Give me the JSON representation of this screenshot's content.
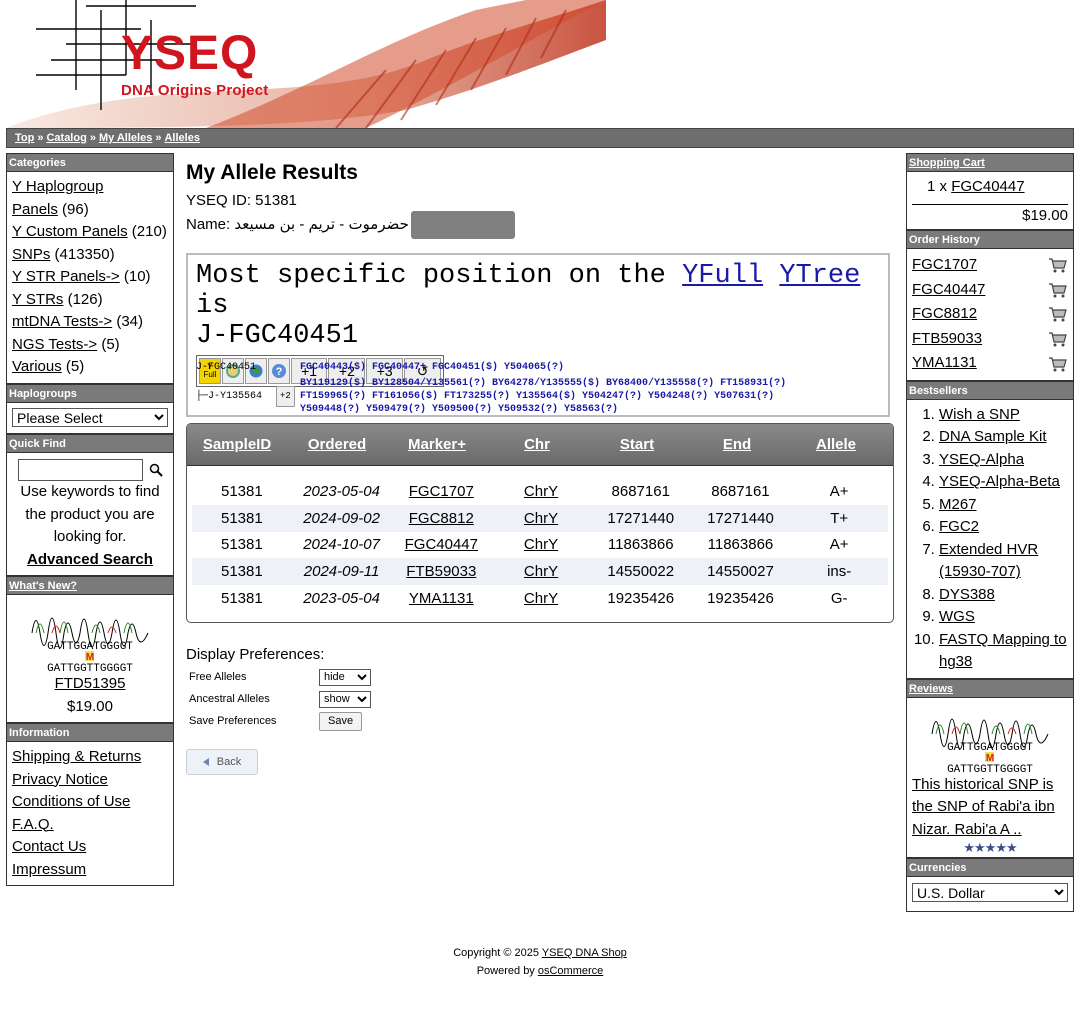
{
  "header": {
    "logo_title": "YSEQ",
    "logo_subtitle": "DNA Origins Project"
  },
  "breadcrumb": [
    "Top",
    "Catalog",
    "My Alleles",
    "Alleles"
  ],
  "categories": {
    "title": "Categories",
    "items": [
      {
        "label": "Y Haplogroup",
        "count": ""
      },
      {
        "label": "Panels",
        "count": "(96)"
      },
      {
        "label": "Y Custom Panels",
        "count": "(210)"
      },
      {
        "label": "SNPs",
        "count": "(413350)"
      },
      {
        "label": "Y STR Panels->",
        "count": "(10)"
      },
      {
        "label": "Y STRs",
        "count": "(126)"
      },
      {
        "label": "mtDNA Tests->",
        "count": "(34)"
      },
      {
        "label": "NGS Tests->",
        "count": "(5)"
      },
      {
        "label": "Various",
        "count": "(5)"
      }
    ]
  },
  "haplogroups": {
    "title": "Haplogroups",
    "selected": "Please Select"
  },
  "quick_find": {
    "title": "Quick Find",
    "help": "Use keywords to find the product you are looking for.",
    "advanced": "Advanced Search"
  },
  "whats_new": {
    "title": "What's New?",
    "product": "FTD51395",
    "price": "$19.00"
  },
  "information": {
    "title": "Information",
    "items": [
      "Shipping & Returns",
      "Privacy Notice",
      "Conditions of Use",
      "F.A.Q.",
      "Contact Us",
      "Impressum"
    ]
  },
  "main": {
    "title": "My Allele Results",
    "yseq_id_label": "YSEQ ID: 51381",
    "name_label": "Name:",
    "name_value": "حضرموت - تريم - بن مسيعد",
    "yfull": {
      "prefix": "Most specific position on the",
      "link1": "YFull",
      "link2": "YTree",
      "suffix": "is",
      "haplogroup": "J-FGC40451",
      "buttons": [
        "Y Full",
        "",
        "",
        "?",
        "+1",
        "+2",
        "+3",
        "↺"
      ]
    },
    "snp_rows": {
      "node1": "J-FGC40451",
      "node1_snps": "FGC40443($)  FGC40447+  FGC40451($)  Y504065(?)",
      "node2": "├─J-Y135564",
      "node2_button": "+2",
      "node2_line1": "BY119129($)  BY128504/Y135561(?)  BY64278/Y135555($)  BY68400/Y135558(?)  FT158931(?)",
      "node2_line2": "FT159965(?)  FT161056($)  FT173255(?)  Y135564($)  Y504247(?)  Y504248(?)  Y507631(?)",
      "node2_line3": "Y509448(?)  Y509479(?)  Y509500(?)  Y509532(?)  Y58563(?)"
    },
    "table": {
      "headers": [
        "SampleID",
        "Ordered",
        "Marker+",
        "Chr",
        "Start",
        "End",
        "Allele"
      ],
      "rows": [
        [
          "51381",
          "2023-05-04",
          "FGC1707",
          "ChrY",
          "8687161",
          "8687161",
          "A+"
        ],
        [
          "51381",
          "2024-09-02",
          "FGC8812",
          "ChrY",
          "17271440",
          "17271440",
          "T+"
        ],
        [
          "51381",
          "2024-10-07",
          "FGC40447",
          "ChrY",
          "11863866",
          "11863866",
          "A+"
        ],
        [
          "51381",
          "2024-09-11",
          "FTB59033",
          "ChrY",
          "14550022",
          "14550027",
          "ins-"
        ],
        [
          "51381",
          "2023-05-04",
          "YMA1131",
          "ChrY",
          "19235426",
          "19235426",
          "G-"
        ]
      ]
    },
    "prefs": {
      "title": "Display Preferences:",
      "free_label": "Free Alleles",
      "free_value": "hide",
      "anc_label": "Ancestral Alleles",
      "anc_value": "show",
      "save_label": "Save Preferences",
      "save_button": "Save"
    },
    "back": "Back"
  },
  "cart": {
    "title": "Shopping Cart",
    "qty": "1 x",
    "item": "FGC40447",
    "total": "$19.00"
  },
  "order_history": {
    "title": "Order History",
    "items": [
      "FGC1707",
      "FGC40447",
      "FGC8812",
      "FTB59033",
      "YMA1131"
    ]
  },
  "bestsellers": {
    "title": "Bestsellers",
    "items": [
      "Wish a SNP",
      "DNA Sample Kit",
      "YSEQ-Alpha",
      "YSEQ-Alpha-Beta",
      "M267",
      "FGC2",
      "Extended HVR (15930-707)",
      "DYS388",
      "WGS",
      "FASTQ Mapping to hg38"
    ]
  },
  "reviews": {
    "title": "Reviews",
    "text": "This historical SNP is the SNP of Rabi'a ibn Nizar. Rabi'a A ..",
    "rating": 5
  },
  "currencies": {
    "title": "Currencies",
    "selected": "U.S. Dollar"
  },
  "footer": {
    "copyright": "Copyright © 2025",
    "shop": "YSEQ DNA Shop",
    "powered": "Powered by",
    "engine": "osCommerce"
  },
  "colors": {
    "logo_red": "#d0151f",
    "link_blue": "#1a1aa6",
    "header_gray": "#7a7a7a"
  }
}
